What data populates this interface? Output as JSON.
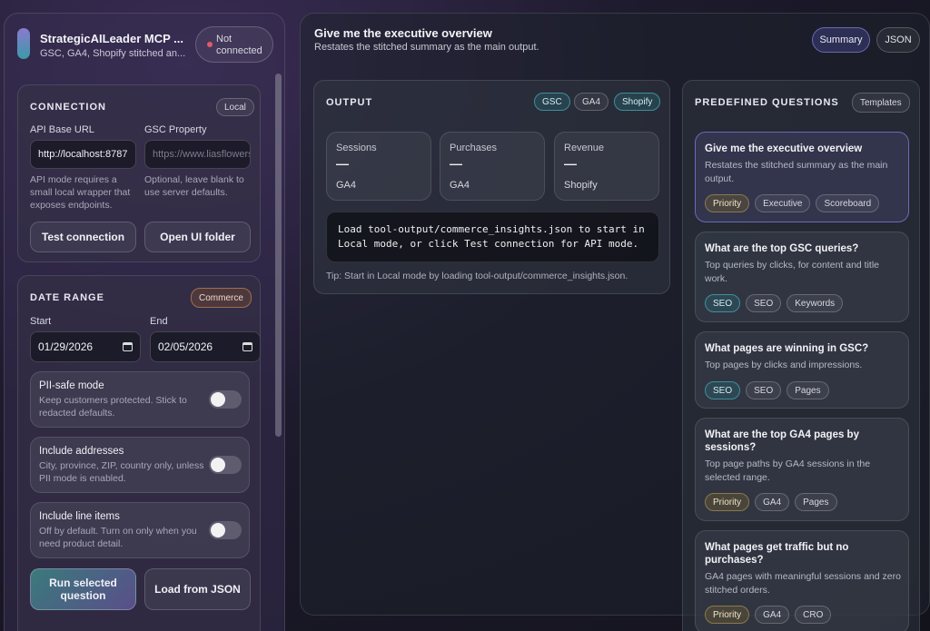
{
  "app": {
    "title": "StrategicAILeader MCP ...",
    "subtitle": "GSC, GA4, Shopify stitched an...",
    "status": "Not connected"
  },
  "connection": {
    "title": "CONNECTION",
    "badge": "Local",
    "api_label": "API Base URL",
    "api_value": "http://localhost:8787",
    "api_help": "API mode requires a small local wrapper that exposes endpoints.",
    "gsc_label": "GSC Property",
    "gsc_placeholder": "https://www.liasflowers.com",
    "gsc_help": "Optional, leave blank to use server defaults.",
    "test_button": "Test connection",
    "open_button": "Open UI folder"
  },
  "date_range": {
    "title": "DATE RANGE",
    "badge": "Commerce",
    "start_label": "Start",
    "start_value": "01/29/2026",
    "end_label": "End",
    "end_value": "02/05/2026"
  },
  "toggles": [
    {
      "title": "PII-safe mode",
      "desc": "Keep customers protected. Stick to redacted defaults."
    },
    {
      "title": "Include addresses",
      "desc": "City, province, ZIP, country only, unless PII mode is enabled."
    },
    {
      "title": "Include line items",
      "desc": "Off by default. Turn on only when you need product detail."
    }
  ],
  "actions": {
    "run": "Run selected question",
    "load": "Load from JSON"
  },
  "header": {
    "title": "Give me the executive overview",
    "subtitle": "Restates the stitched summary as the main output.",
    "tab_summary": "Summary",
    "tab_json": "JSON"
  },
  "output": {
    "title": "OUTPUT",
    "sources": [
      "GSC",
      "GA4",
      "Shopify"
    ],
    "metrics": [
      {
        "label": "Sessions",
        "value": "—",
        "source": "GA4"
      },
      {
        "label": "Purchases",
        "value": "—",
        "source": "GA4"
      },
      {
        "label": "Revenue",
        "value": "—",
        "source": "Shopify"
      }
    ],
    "message": "Load tool-output/commerce_insights.json to start in Local mode, or click Test connection for API mode.",
    "tip": "Tip: Start in Local mode by loading tool-output/commerce_insights.json."
  },
  "questions": {
    "title": "PREDEFINED QUESTIONS",
    "templates": "Templates",
    "items": [
      {
        "title": "Give me the executive overview",
        "desc": "Restates the stitched summary as the main output.",
        "tags": [
          "Priority",
          "Executive",
          "Scoreboard"
        ]
      },
      {
        "title": "What are the top GSC queries?",
        "desc": "Top queries by clicks, for content and title work.",
        "tags": [
          "SEO",
          "SEO",
          "Keywords"
        ]
      },
      {
        "title": "What pages are winning in GSC?",
        "desc": "Top pages by clicks and impressions.",
        "tags": [
          "SEO",
          "SEO",
          "Pages"
        ]
      },
      {
        "title": "What are the top GA4 pages by sessions?",
        "desc": "Top page paths by GA4 sessions in the selected range.",
        "tags": [
          "Priority",
          "GA4",
          "Pages"
        ]
      },
      {
        "title": "What pages get traffic but no purchases?",
        "desc": "GA4 pages with meaningful sessions and zero stitched orders.",
        "tags": [
          "Priority",
          "GA4",
          "CRO"
        ]
      }
    ]
  }
}
